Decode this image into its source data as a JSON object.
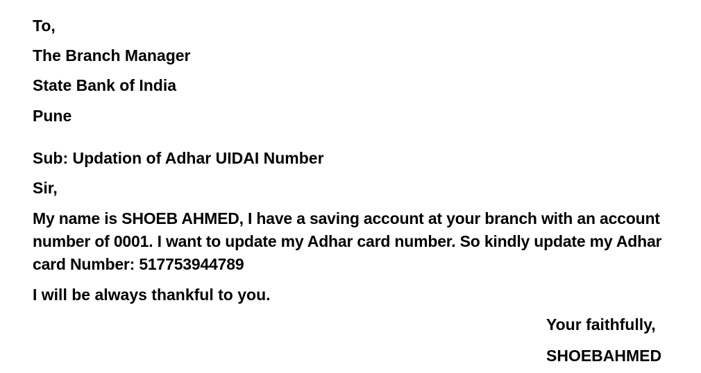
{
  "letter": {
    "salutation_to": "To,",
    "recipient_title": "The Branch Manager",
    "recipient_bank": "State Bank of India",
    "recipient_city": "Pune",
    "subject": "Sub: Updation of Adhar UIDAI Number",
    "greeting": "Sir,",
    "body": "My name is SHOEB AHMED, I have a saving account at your branch with an account number of 0001. I want to update my Adhar card number. So kindly update my Adhar card Number: 517753944789",
    "closing_line": "I will be always thankful to you.",
    "sign_off": "Your faithfully,",
    "signature_name": "SHOEBAHMED"
  }
}
